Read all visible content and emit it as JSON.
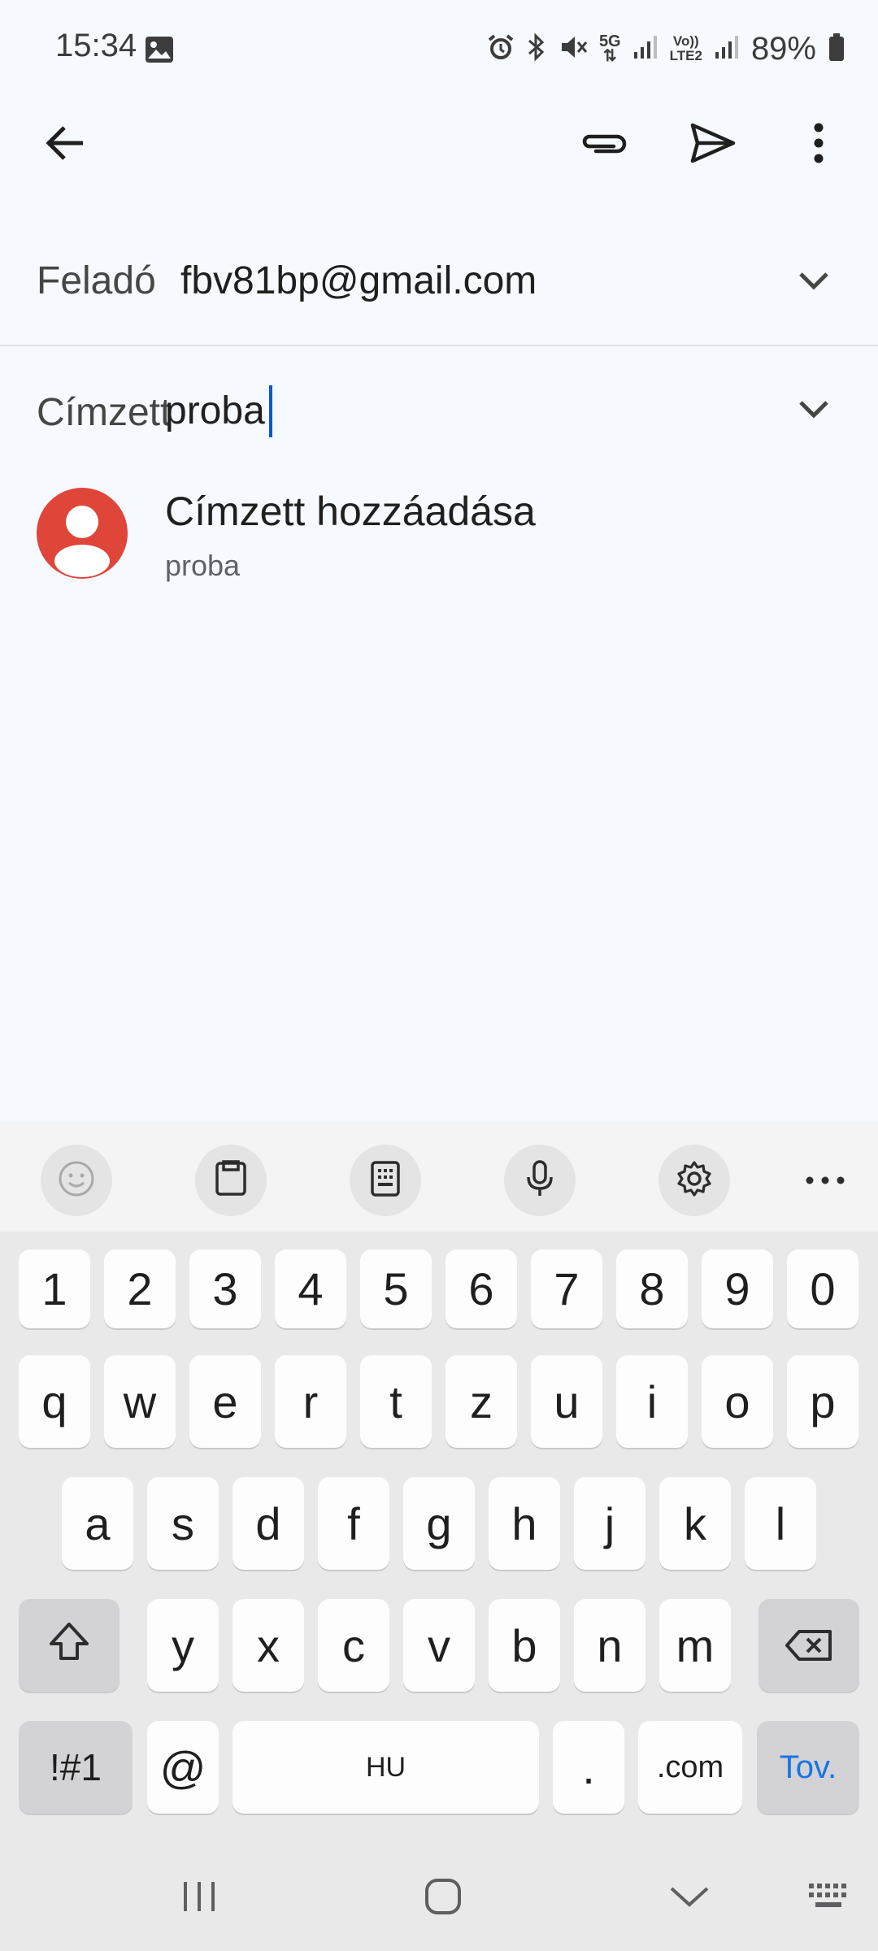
{
  "status_bar": {
    "time": "15:34",
    "battery": "89%",
    "icons": [
      "image-icon",
      "alarm-icon",
      "bluetooth-icon",
      "mute-icon",
      "5g-icon",
      "signal-icon",
      "volte-icon",
      "signal-icon",
      "battery-icon"
    ]
  },
  "app_bar": {
    "icons": [
      "back-arrow-icon",
      "attach-icon",
      "send-icon",
      "more-vert-icon"
    ]
  },
  "compose": {
    "from_label": "Feladó",
    "from_value": "fbv81bp@gmail.com",
    "to_label": "Címzett",
    "to_value": "proba"
  },
  "suggestion": {
    "title": "Címzett hozzáadása",
    "subtitle": "proba",
    "avatar_color": "#e0453a"
  },
  "keyboard": {
    "toolbar_icons": [
      "emoji-icon",
      "clipboard-icon",
      "keypad-icon",
      "mic-icon",
      "settings-icon",
      "more-horiz-icon"
    ],
    "row_numbers": [
      "1",
      "2",
      "3",
      "4",
      "5",
      "6",
      "7",
      "8",
      "9",
      "0"
    ],
    "row1": [
      "q",
      "w",
      "e",
      "r",
      "t",
      "z",
      "u",
      "i",
      "o",
      "p"
    ],
    "row2": [
      "a",
      "s",
      "d",
      "f",
      "g",
      "h",
      "j",
      "k",
      "l"
    ],
    "row3": [
      "y",
      "x",
      "c",
      "v",
      "b",
      "n",
      "m"
    ],
    "symbols": "!#1",
    "at": "@",
    "space": "HU",
    "period": ".",
    "dotcom": ".com",
    "next": "Tov."
  },
  "nav_bar": {
    "icons": [
      "recents-icon",
      "home-icon",
      "hide-keyboard-icon",
      "keyboard-switch-icon"
    ]
  },
  "colors": {
    "accent": "#1a73e8",
    "background": "#f6f9fe",
    "keyboard_bg": "#e9e9ea"
  }
}
